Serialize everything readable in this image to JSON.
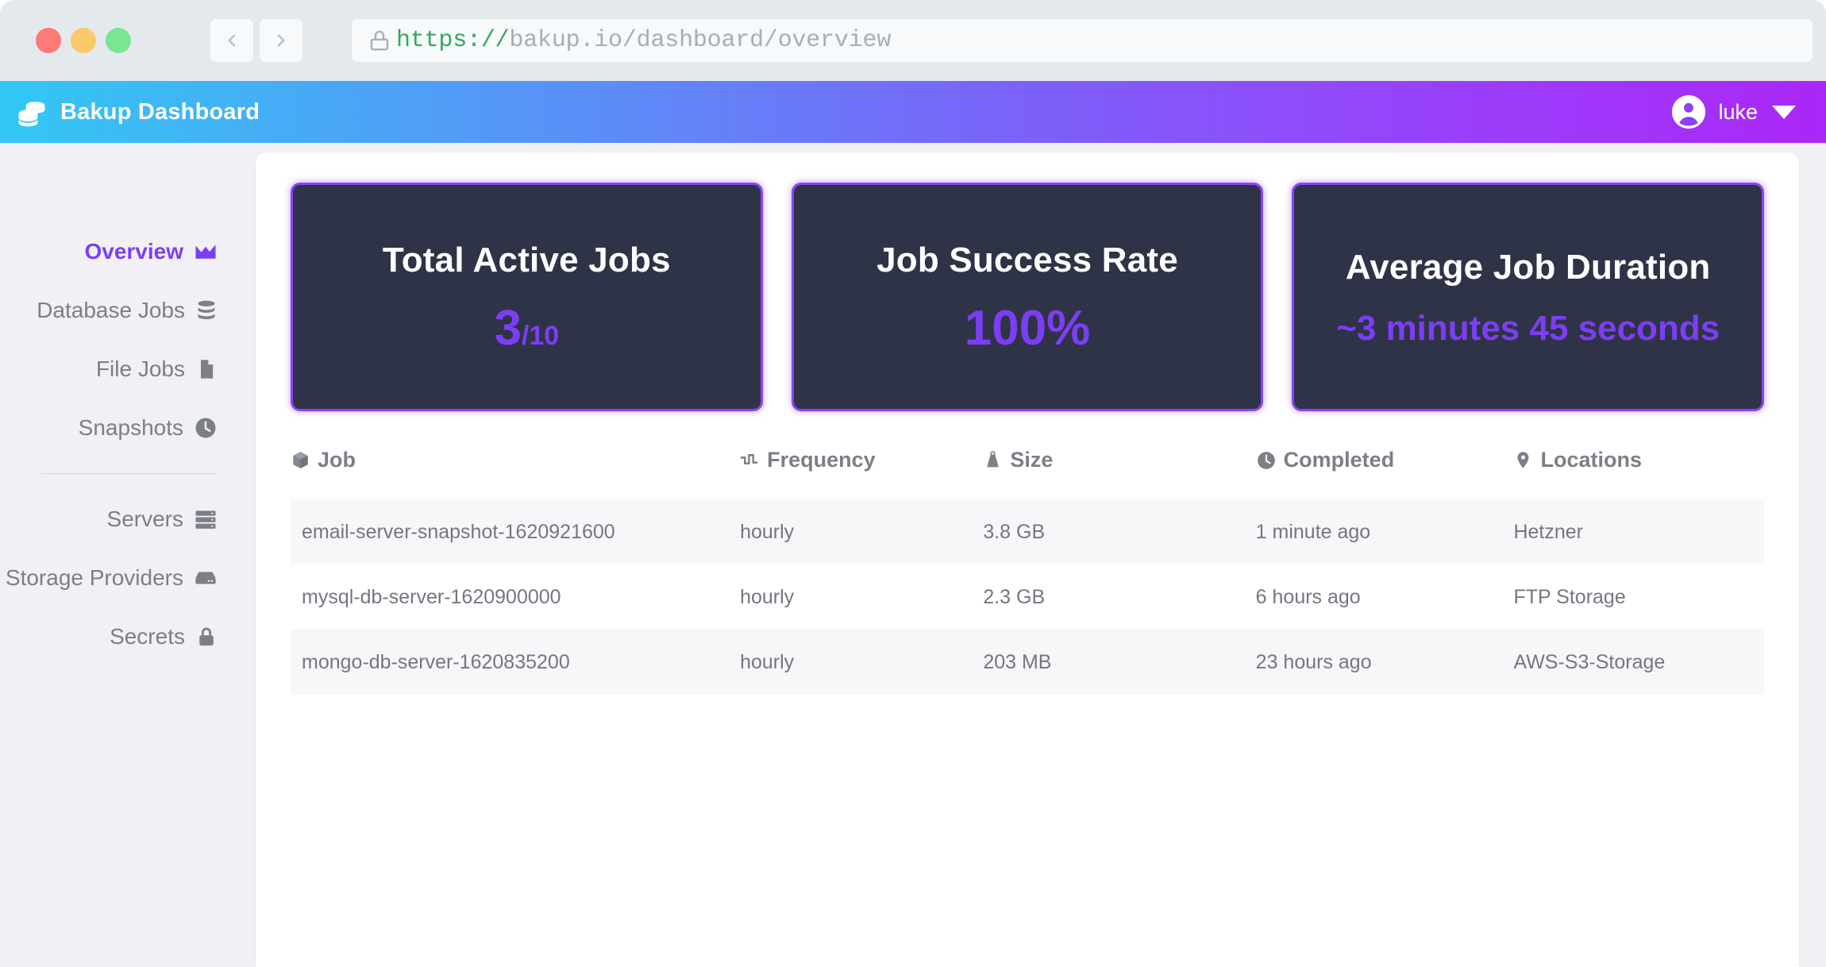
{
  "browser": {
    "back_label": "Back",
    "forward_label": "Forward",
    "url_scheme": "https://",
    "url_rest": "bakup.io/dashboard/overview",
    "lock_icon": "lock-icon",
    "traffic_lights": [
      "close",
      "minimize",
      "maximize"
    ]
  },
  "header": {
    "brand": "Bakup Dashboard",
    "brand_icon": "database-stack-icon",
    "user": "luke",
    "user_icon": "user-avatar-icon",
    "caret_icon": "chevron-down-icon",
    "gradient_start": "#32c8f3",
    "gradient_end": "#ab27f7"
  },
  "sidebar": {
    "items": [
      {
        "label": "Overview",
        "icon": "area-chart-icon",
        "active": true
      },
      {
        "label": "Database Jobs",
        "icon": "database-icon",
        "active": false
      },
      {
        "label": "File Jobs",
        "icon": "file-icon",
        "active": false
      },
      {
        "label": "Snapshots",
        "icon": "clock-icon",
        "active": false
      }
    ],
    "items_secondary": [
      {
        "label": "Servers",
        "icon": "server-icon",
        "active": false
      },
      {
        "label": "Storage Providers",
        "icon": "hard-drive-icon",
        "active": false
      },
      {
        "label": "Secrets",
        "icon": "lock-icon",
        "active": false
      }
    ],
    "active_color": "#7b3ff2"
  },
  "stats": [
    {
      "title": "Total Active Jobs",
      "value": "3",
      "suffix": "/10",
      "small": false
    },
    {
      "title": "Job Success Rate",
      "value": "100%",
      "suffix": "",
      "small": false
    },
    {
      "title": "Average Job Duration",
      "value": "~3 minutes 45 seconds",
      "suffix": "",
      "small": true
    }
  ],
  "table": {
    "columns": [
      {
        "label": "Job",
        "icon": "cube-icon"
      },
      {
        "label": "Frequency",
        "icon": "pulse-icon"
      },
      {
        "label": "Size",
        "icon": "weight-icon"
      },
      {
        "label": "Completed",
        "icon": "clock-icon"
      },
      {
        "label": "Locations",
        "icon": "map-pin-icon"
      }
    ],
    "rows": [
      {
        "job": "email-server-snapshot-1620921600",
        "frequency": "hourly",
        "size": "3.8 GB",
        "completed": "1 minute ago",
        "location": "Hetzner"
      },
      {
        "job": "mysql-db-server-1620900000",
        "frequency": "hourly",
        "size": "2.3 GB",
        "completed": "6 hours ago",
        "location": "FTP Storage"
      },
      {
        "job": "mongo-db-server-1620835200",
        "frequency": "hourly",
        "size": "203 MB",
        "completed": "23 hours ago",
        "location": "AWS-S3-Storage"
      }
    ]
  }
}
